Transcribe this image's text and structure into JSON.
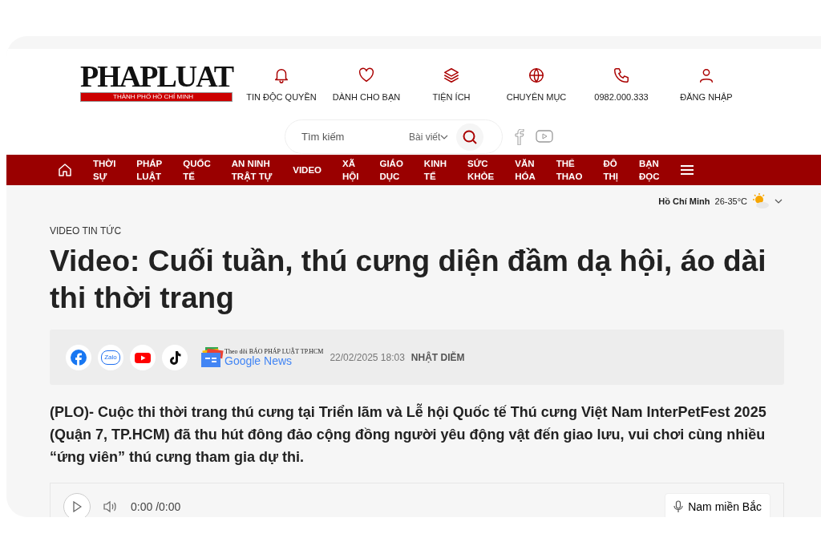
{
  "logo": {
    "title": "PHAPLUAT",
    "subtitle": "THÀNH PHỐ HỒ CHÍ MINH"
  },
  "header_links": [
    {
      "kind": "bell",
      "label": "TIN ĐỘC QUYỀN"
    },
    {
      "kind": "heart",
      "label": "DÀNH CHO BẠN"
    },
    {
      "kind": "layers",
      "label": "TIỆN ÍCH"
    },
    {
      "kind": "globe",
      "label": "CHUYÊN MỤC"
    },
    {
      "kind": "phone",
      "label": "0982.000.333"
    },
    {
      "kind": "user",
      "label": "ĐĂNG NHẬP"
    }
  ],
  "search": {
    "placeholder": "Tìm kiếm",
    "scope": "Bài viết"
  },
  "nav": [
    {
      "lines": [
        "THỜI",
        "SỰ"
      ]
    },
    {
      "lines": [
        "PHÁP",
        "LUẬT"
      ]
    },
    {
      "lines": [
        "QUỐC",
        "TẾ"
      ]
    },
    {
      "lines": [
        "AN NINH",
        "TRẬT TỰ"
      ]
    },
    {
      "lines": [
        "VIDEO"
      ]
    },
    {
      "lines": [
        "XÃ",
        "HỘI"
      ]
    },
    {
      "lines": [
        "GIÁO",
        "DỤC"
      ]
    },
    {
      "lines": [
        "KINH",
        "TẾ"
      ]
    },
    {
      "lines": [
        "SỨC",
        "KHỎE"
      ]
    },
    {
      "lines": [
        "VĂN",
        "HÓA"
      ]
    },
    {
      "lines": [
        "THỂ",
        "THAO"
      ]
    },
    {
      "lines": [
        "ĐÔ",
        "THỊ"
      ]
    },
    {
      "lines": [
        "BẠN",
        "ĐỌC"
      ]
    }
  ],
  "weather": {
    "city": "Hồ Chí Minh",
    "temperature": "26-35°C"
  },
  "article": {
    "category": "VIDEO TIN TỨC",
    "title": "Video: Cuối tuần, thú cưng diện đầm dạ hội, áo dài thi thời trang",
    "share": [
      {
        "kind": "facebook"
      },
      {
        "kind": "zalo",
        "label": "Zalo"
      },
      {
        "kind": "youtube"
      },
      {
        "kind": "tiktok"
      }
    ],
    "google_news": {
      "caption": "Theo dõi BÁO PHÁP LUẬT TP.HCM",
      "label": "Google News"
    },
    "date": "22/02/2025 18:03",
    "author": "NHẬT DIỄM",
    "lead": "(PLO)- Cuộc thi thời trang thú cưng tại Triển lãm và Lễ hội Quốc tế Thú cưng Việt Nam InterPetFest 2025 (Quận 7, TP.HCM) đã thu hút đông đảo cộng đồng người yêu động vật đến giao lưu, vui chơi cùng nhiều “ứng viên” thú cưng tham gia dự thi.",
    "audio": {
      "time": "0:00 /0:00",
      "voice": "Nam miền Bắc"
    }
  }
}
